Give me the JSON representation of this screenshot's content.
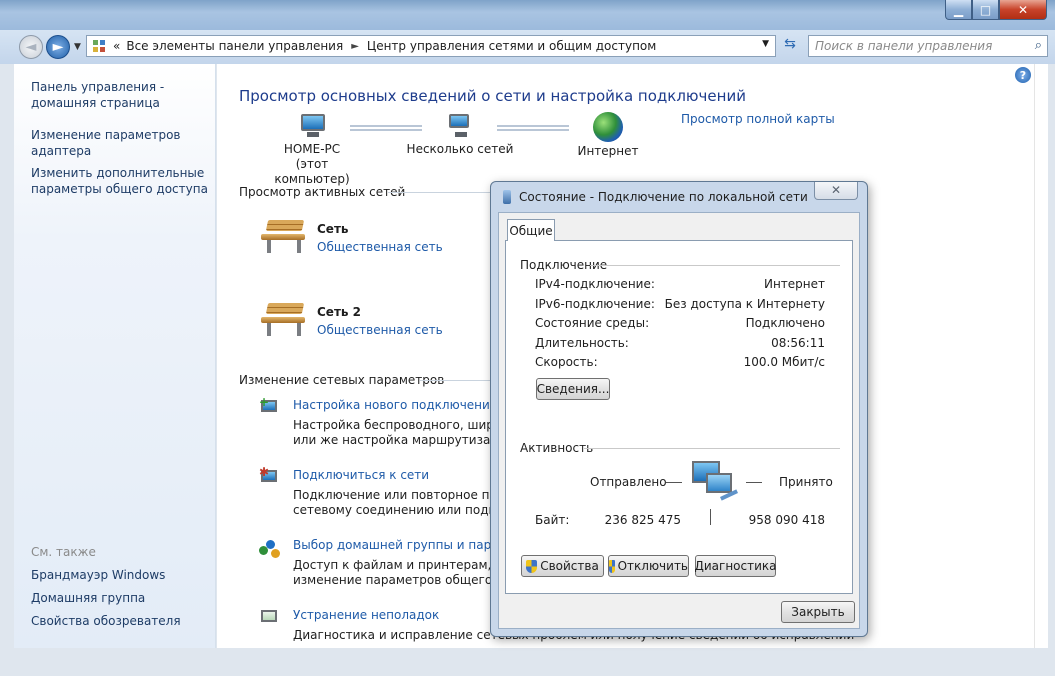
{
  "window": {
    "controls": {
      "minimize": "▁",
      "maximize": "□",
      "close": "✕"
    }
  },
  "address": {
    "breadcrumb_root": "Все элементы панели управления",
    "breadcrumb_current": "Центр управления сетями и общим доступом",
    "separator": "►",
    "search_placeholder": "Поиск в панели управления"
  },
  "sidebar": {
    "links": [
      {
        "label": "Панель управления -\nдомашняя страница"
      },
      {
        "label": "Изменение параметров\nадаптера"
      },
      {
        "label": "Изменить дополнительные\nпараметры общего доступа"
      }
    ],
    "see_also_heading": "См. также",
    "see_also": [
      {
        "label": "Брандмауэр Windows"
      },
      {
        "label": "Домашняя группа"
      },
      {
        "label": "Свойства обозревателя"
      }
    ]
  },
  "main": {
    "title": "Просмотр основных сведений о сети и настройка подключений",
    "full_map_link": "Просмотр полной карты",
    "map": {
      "computer_name": "HOME-PC",
      "computer_sub": "(этот компьютер)",
      "middle": "Несколько сетей",
      "internet": "Интернет"
    },
    "active_networks_heading": "Просмотр активных сетей",
    "networks": [
      {
        "name": "Сеть",
        "type": "Общественная сеть"
      },
      {
        "name": "Сеть  2",
        "type": "Общественная сеть"
      }
    ],
    "change_settings_heading": "Изменение сетевых параметров",
    "tasks": [
      {
        "link": "Настройка нового подключения или",
        "desc1": "Настройка беспроводного, широко",
        "desc2": "или же настройка маршрутизатора"
      },
      {
        "link": "Подключиться к сети",
        "desc1": "Подключение или повторное подкл",
        "desc2": "сетевому соединению или подклю"
      },
      {
        "link": "Выбор домашней группы и параме",
        "desc1": "Доступ к файлам и принтерам, расп",
        "desc2": "изменение параметров общего дос"
      },
      {
        "link": "Устранение неполадок",
        "desc1": "Диагностика и исправление сетевых проблем или получение сведений об исправлении"
      }
    ]
  },
  "dialog": {
    "title": "Состояние - Подключение по локальной сети",
    "close": "✕",
    "tab": "Общие",
    "connection_heading": "Подключение",
    "rows": [
      {
        "key": "IPv4-подключение:",
        "value": "Интернет"
      },
      {
        "key": "IPv6-подключение:",
        "value": "Без доступа к Интернету"
      },
      {
        "key": "Состояние среды:",
        "value": "Подключено"
      },
      {
        "key": "Длительность:",
        "value": "08:56:11"
      },
      {
        "key": "Скорость:",
        "value": "100.0 Мбит/с"
      }
    ],
    "details_button": "Сведения...",
    "activity_heading": "Активность",
    "sent_label": "Отправлено",
    "received_label": "Принято",
    "bytes_label": "Байт:",
    "bytes_sent": "236 825 475",
    "bytes_received": "958 090 418",
    "buttons": {
      "properties": "Свойства",
      "disable": "Отключить",
      "diagnose": "Диагностика",
      "close": "Закрыть"
    }
  }
}
